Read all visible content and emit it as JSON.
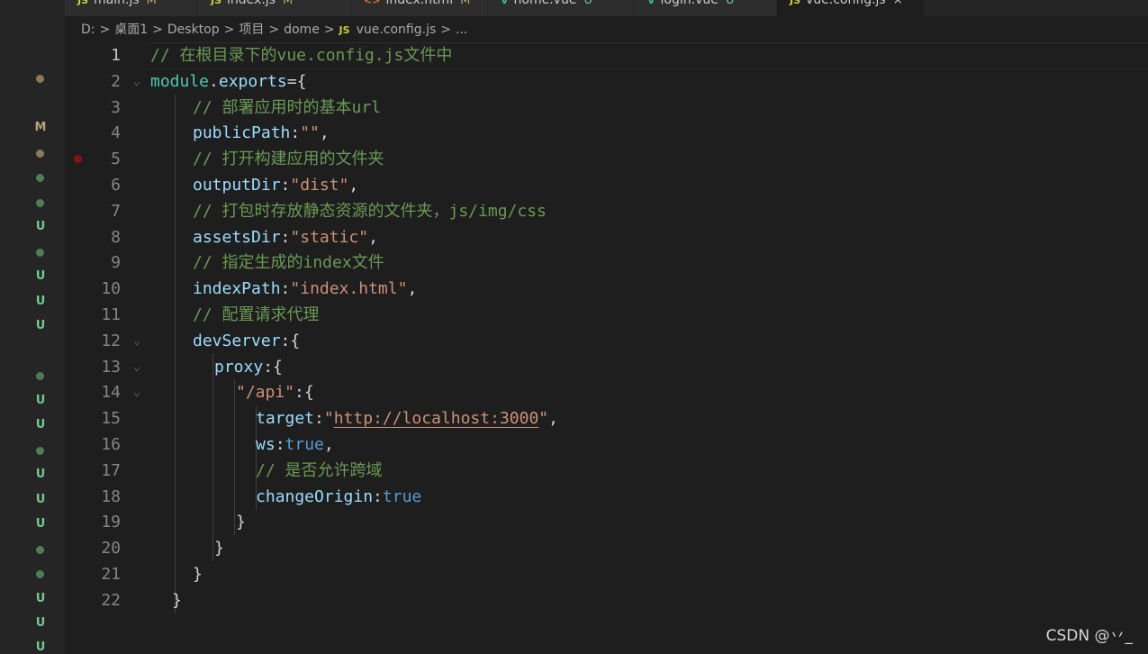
{
  "tabs": [
    {
      "lang": "JS",
      "name": "main.js",
      "status": "M",
      "lang_color": "#cbcb41",
      "status_color": "#c7a96b"
    },
    {
      "lang": "JS",
      "name": "index.js",
      "status": "M",
      "lang_color": "#cbcb41",
      "status_color": "#c7a96b"
    },
    {
      "lang": "<>",
      "name": "index.html",
      "status": "M",
      "lang_color": "#e37933",
      "status_color": "#c7a96b"
    },
    {
      "lang": "V",
      "name": "home.vue",
      "status": "U",
      "lang_color": "#41b883",
      "status_color": "#73c991"
    },
    {
      "lang": "V",
      "name": "login.vue",
      "status": "U",
      "lang_color": "#41b883",
      "status_color": "#73c991"
    },
    {
      "lang": "JS",
      "name": "vue.config.js",
      "status": "×",
      "lang_color": "#cbcb41",
      "status_color": "#cccccc"
    }
  ],
  "breadcrumb": {
    "parts": [
      "D:",
      "桌面1",
      "Desktop",
      "项目",
      "dome"
    ],
    "file_badge": "JS",
    "file": "vue.config.js",
    "ellipsis": "...",
    "separator": ">"
  },
  "explorer_marks": [
    {
      "kind": "dot",
      "color": "#8a7a5a"
    },
    {
      "kind": "text",
      "text": "M",
      "color": "#b8a17a"
    },
    {
      "kind": "dot",
      "color": "#8a7a5a"
    },
    {
      "kind": "dot",
      "color": "#4f7d56"
    },
    {
      "kind": "dot",
      "color": "#4f7d56"
    },
    {
      "kind": "text",
      "text": "U",
      "color": "#73c991"
    },
    {
      "kind": "dot",
      "color": "#4f7d56"
    },
    {
      "kind": "text",
      "text": "U",
      "color": "#73c991"
    },
    {
      "kind": "text",
      "text": "U",
      "color": "#73c991"
    },
    {
      "kind": "text",
      "text": "U",
      "color": "#73c991"
    },
    {
      "kind": "dot",
      "color": "#4f7d56"
    },
    {
      "kind": "text",
      "text": "U",
      "color": "#73c991"
    },
    {
      "kind": "text",
      "text": "U",
      "color": "#73c991"
    },
    {
      "kind": "dot",
      "color": "#4f7d56"
    },
    {
      "kind": "text",
      "text": "U",
      "color": "#73c991"
    },
    {
      "kind": "text",
      "text": "U",
      "color": "#73c991"
    },
    {
      "kind": "text",
      "text": "U",
      "color": "#73c991"
    },
    {
      "kind": "dot",
      "color": "#4f7d56"
    },
    {
      "kind": "dot",
      "color": "#4f7d56"
    },
    {
      "kind": "text",
      "text": "U",
      "color": "#73c991"
    },
    {
      "kind": "text",
      "text": "U",
      "color": "#73c991"
    },
    {
      "kind": "text",
      "text": "U",
      "color": "#73c991"
    }
  ],
  "editor": {
    "current_line": 1,
    "breakpoint_line": 5,
    "lines": [
      {
        "n": "1",
        "indent": 0,
        "fold": false,
        "tokens": [
          [
            "// 在根目录下的vue.config.js文件中",
            "comment"
          ]
        ]
      },
      {
        "n": "2",
        "indent": 0,
        "fold": true,
        "tokens": [
          [
            "module",
            "var"
          ],
          [
            ".",
            "punc"
          ],
          [
            "exports",
            "prop"
          ],
          [
            "={",
            "punc"
          ]
        ]
      },
      {
        "n": "3",
        "indent": 1,
        "fold": false,
        "tokens": [
          [
            "// 部署应用时的基本url",
            "comment"
          ]
        ]
      },
      {
        "n": "4",
        "indent": 1,
        "fold": false,
        "tokens": [
          [
            "publicPath",
            "prop"
          ],
          [
            ":",
            "punc"
          ],
          [
            "\"\"",
            "str"
          ],
          [
            ",",
            "punc"
          ]
        ]
      },
      {
        "n": "5",
        "indent": 1,
        "fold": false,
        "tokens": [
          [
            "// 打开构建应用的文件夹",
            "comment"
          ]
        ]
      },
      {
        "n": "6",
        "indent": 1,
        "fold": false,
        "tokens": [
          [
            "outputDir",
            "prop"
          ],
          [
            ":",
            "punc"
          ],
          [
            "\"dist\"",
            "str"
          ],
          [
            ",",
            "punc"
          ]
        ]
      },
      {
        "n": "7",
        "indent": 1,
        "fold": false,
        "tokens": [
          [
            "// 打包时存放静态资源的文件夹，js/img/css",
            "comment"
          ]
        ]
      },
      {
        "n": "8",
        "indent": 1,
        "fold": false,
        "tokens": [
          [
            "assetsDir",
            "prop"
          ],
          [
            ":",
            "punc"
          ],
          [
            "\"static\"",
            "str"
          ],
          [
            ",",
            "punc"
          ]
        ]
      },
      {
        "n": "9",
        "indent": 1,
        "fold": false,
        "tokens": [
          [
            "// 指定生成的index文件",
            "comment"
          ]
        ]
      },
      {
        "n": "10",
        "indent": 1,
        "fold": false,
        "tokens": [
          [
            "indexPath",
            "prop"
          ],
          [
            ":",
            "punc"
          ],
          [
            "\"index.html\"",
            "str"
          ],
          [
            ",",
            "punc"
          ]
        ]
      },
      {
        "n": "11",
        "indent": 1,
        "fold": false,
        "tokens": [
          [
            "// 配置请求代理",
            "comment"
          ]
        ]
      },
      {
        "n": "12",
        "indent": 1,
        "fold": true,
        "tokens": [
          [
            "devServer",
            "prop"
          ],
          [
            ":{",
            "punc"
          ]
        ]
      },
      {
        "n": "13",
        "indent": 2,
        "fold": true,
        "tokens": [
          [
            "proxy",
            "prop"
          ],
          [
            ":{",
            "punc"
          ]
        ]
      },
      {
        "n": "14",
        "indent": 3,
        "fold": true,
        "tokens": [
          [
            "\"/api\"",
            "str"
          ],
          [
            ":{",
            "punc"
          ]
        ]
      },
      {
        "n": "15",
        "indent": 4,
        "fold": false,
        "tokens": [
          [
            "target",
            "prop"
          ],
          [
            ":",
            "punc"
          ],
          [
            "\"",
            "str"
          ],
          [
            "http://localhost:3000",
            "url"
          ],
          [
            "\"",
            "str"
          ],
          [
            ",",
            "punc"
          ]
        ]
      },
      {
        "n": "16",
        "indent": 4,
        "fold": false,
        "tokens": [
          [
            "ws",
            "prop"
          ],
          [
            ":",
            "punc"
          ],
          [
            "true",
            "bool"
          ],
          [
            ",",
            "punc"
          ]
        ]
      },
      {
        "n": "17",
        "indent": 4,
        "fold": false,
        "tokens": [
          [
            "// 是否允许跨域",
            "comment"
          ]
        ]
      },
      {
        "n": "18",
        "indent": 4,
        "fold": false,
        "tokens": [
          [
            "changeOrigin",
            "prop"
          ],
          [
            ":",
            "punc"
          ],
          [
            "true",
            "bool"
          ]
        ]
      },
      {
        "n": "19",
        "indent": 3,
        "fold": false,
        "tokens": [
          [
            "}",
            "punc"
          ]
        ]
      },
      {
        "n": "20",
        "indent": 2,
        "fold": false,
        "tokens": [
          [
            "}",
            "punc"
          ]
        ]
      },
      {
        "n": "21",
        "indent": 1,
        "fold": false,
        "tokens": [
          [
            "}",
            "punc"
          ]
        ]
      },
      {
        "n": "22",
        "indent": 0.5,
        "fold": false,
        "tokens": [
          [
            "}",
            "punc"
          ]
        ]
      }
    ]
  },
  "watermark": "CSDN @丷_"
}
